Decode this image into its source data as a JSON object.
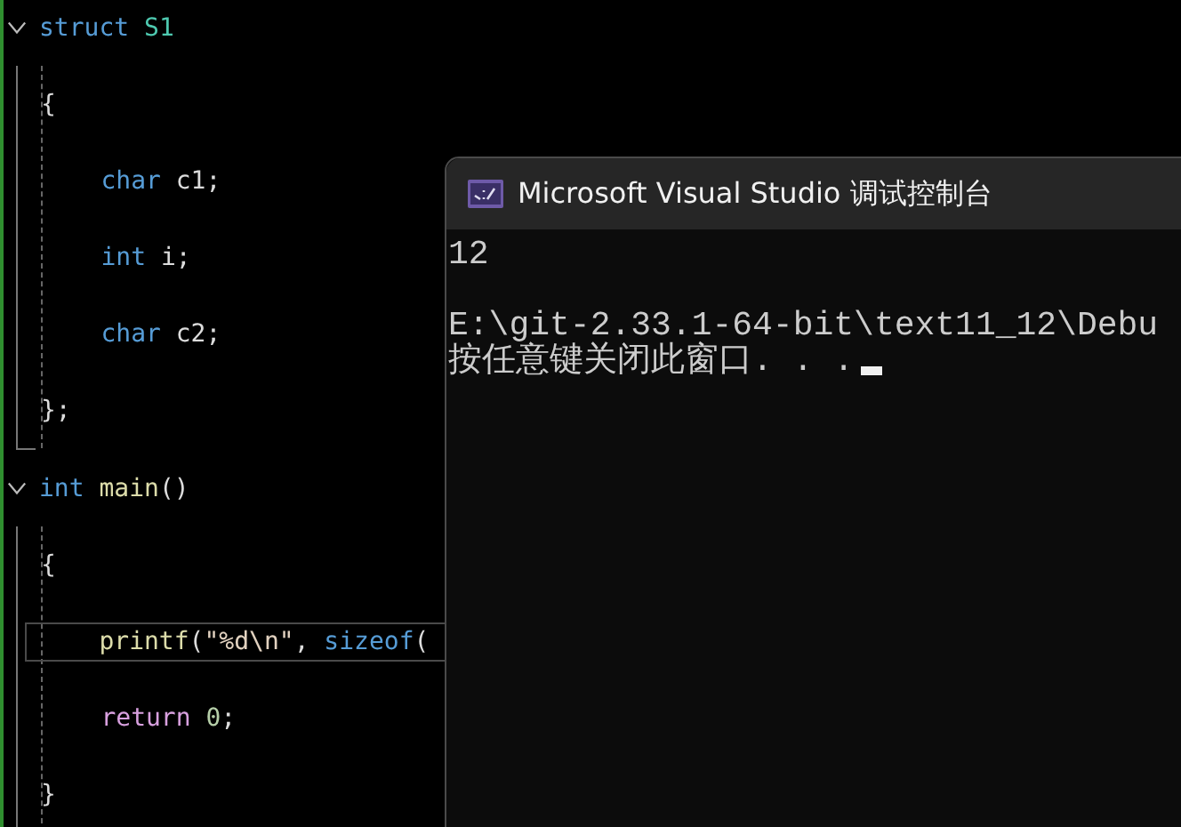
{
  "editor": {
    "blocks": [
      {
        "expanded": true,
        "header": [
          {
            "text": "struct ",
            "kind": "keyword"
          },
          {
            "text": "S1",
            "kind": "type"
          }
        ],
        "lines": [
          {
            "current": false,
            "tokens": [
              {
                "text": "{",
                "kind": "plain"
              }
            ]
          },
          {
            "current": false,
            "tokens": [
              {
                "text": "    char",
                "kind": "keyword"
              },
              {
                "text": " c1;",
                "kind": "plain"
              }
            ]
          },
          {
            "current": false,
            "tokens": [
              {
                "text": "    int",
                "kind": "keyword"
              },
              {
                "text": " i;",
                "kind": "plain"
              }
            ]
          },
          {
            "current": false,
            "tokens": [
              {
                "text": "    char",
                "kind": "keyword"
              },
              {
                "text": " c2;",
                "kind": "plain"
              }
            ]
          },
          {
            "current": false,
            "tokens": [
              {
                "text": "};",
                "kind": "plain"
              }
            ]
          }
        ]
      },
      {
        "expanded": true,
        "header": [
          {
            "text": "int ",
            "kind": "keyword"
          },
          {
            "text": "main",
            "kind": "function"
          },
          {
            "text": "()",
            "kind": "plain"
          }
        ],
        "lines": [
          {
            "current": false,
            "tokens": [
              {
                "text": "{",
                "kind": "plain"
              }
            ]
          },
          {
            "current": true,
            "tokens": [
              {
                "text": "    printf",
                "kind": "function"
              },
              {
                "text": "(",
                "kind": "plain"
              },
              {
                "text": "\"%d\\n\"",
                "kind": "string"
              },
              {
                "text": ", ",
                "kind": "plain"
              },
              {
                "text": "sizeof",
                "kind": "keyword"
              },
              {
                "text": "(",
                "kind": "plain"
              }
            ]
          },
          {
            "current": false,
            "tokens": [
              {
                "text": "    return ",
                "kind": "control"
              },
              {
                "text": "0",
                "kind": "number"
              },
              {
                "text": ";",
                "kind": "plain"
              }
            ]
          },
          {
            "current": false,
            "tokens": [
              {
                "text": "}",
                "kind": "plain"
              }
            ]
          }
        ]
      }
    ]
  },
  "console": {
    "title": "Microsoft Visual Studio 调试控制台",
    "paragraphs": [
      [
        "12"
      ],
      [
        "E:\\git-2.33.1-64-bit\\text11_12\\Debu",
        "按任意键关闭此窗口. . ."
      ]
    ],
    "cursor": true
  }
}
